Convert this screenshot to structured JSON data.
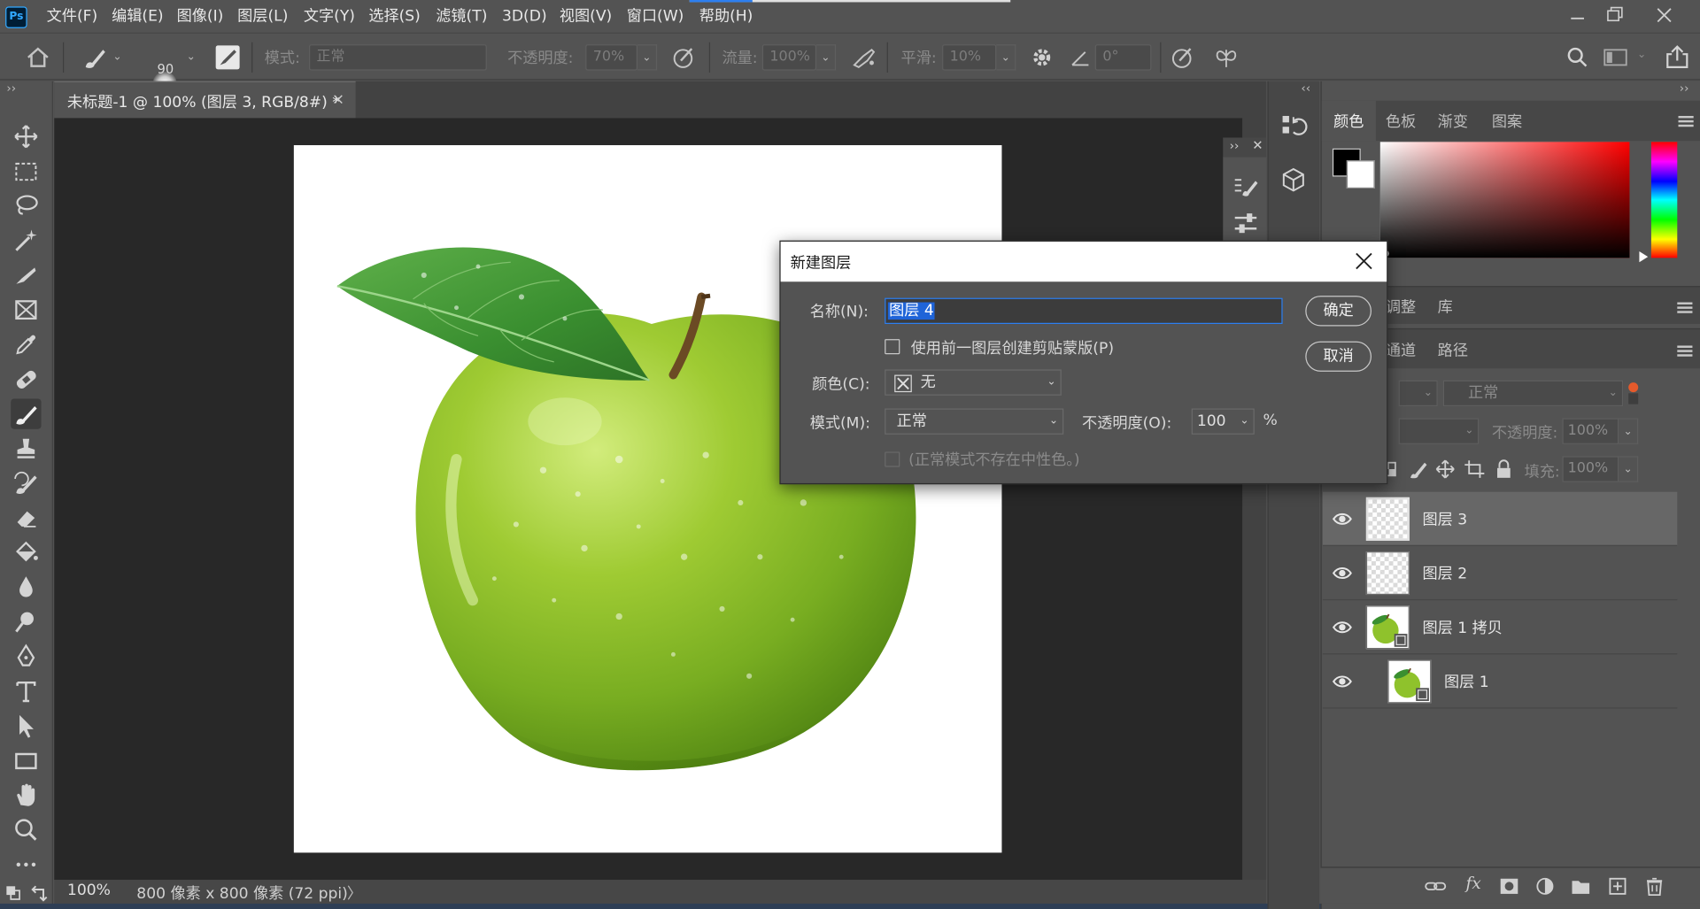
{
  "app": {
    "logo": "Ps",
    "menus": [
      "文件(F)",
      "编辑(E)",
      "图像(I)",
      "图层(L)",
      "文字(Y)",
      "选择(S)",
      "滤镜(T)",
      "3D(D)",
      "视图(V)",
      "窗口(W)",
      "帮助(H)"
    ]
  },
  "options": {
    "brush_size": "90",
    "mode_label": "模式:",
    "mode_value": "正常",
    "opacity_label": "不透明度:",
    "opacity_value": "70%",
    "flow_label": "流量:",
    "flow_value": "100%",
    "smooth_label": "平滑:",
    "smooth_value": "10%",
    "angle_value": "0°"
  },
  "document": {
    "tab_title": "未标题-1 @ 100% (图层 3, RGB/8#) *",
    "close": "×",
    "zoom": "100%",
    "info": "800 像素 x 800 像素 (72 ppi)",
    "info_arrow": "〉"
  },
  "panels": {
    "color_tabs": [
      "颜色",
      "色板",
      "渐变",
      "图案"
    ],
    "adjust_tabs": [
      "调整",
      "库"
    ],
    "layer_tabs": [
      "通道",
      "路径"
    ],
    "blend_mode": "正常",
    "opacity_label": "不透明度:",
    "opacity_value": "100%",
    "fill_label": "填充:",
    "fill_value": "100%"
  },
  "layers": [
    {
      "name": "图层 3",
      "selected": true,
      "type": "empty"
    },
    {
      "name": "图层 2",
      "selected": false,
      "type": "empty"
    },
    {
      "name": "图层 1 拷贝",
      "selected": false,
      "type": "apple"
    },
    {
      "name": "图层 1",
      "selected": false,
      "type": "apple"
    }
  ],
  "dialog": {
    "title": "新建图层",
    "name_label": "名称(N):",
    "name_value": "图层 4",
    "clip_label": "使用前一图层创建剪贴蒙版(P)",
    "color_label": "颜色(C):",
    "color_value": "无",
    "mode_label": "模式(M):",
    "mode_value": "正常",
    "opacity_label": "不透明度(O):",
    "opacity_value": "100",
    "percent": "%",
    "neutral_label": "(正常模式不存在中性色。)",
    "ok": "确定",
    "cancel": "取消"
  },
  "colors": {
    "foreground": "#000000",
    "background": "#ffffff",
    "accent": "#2d7ff0"
  }
}
